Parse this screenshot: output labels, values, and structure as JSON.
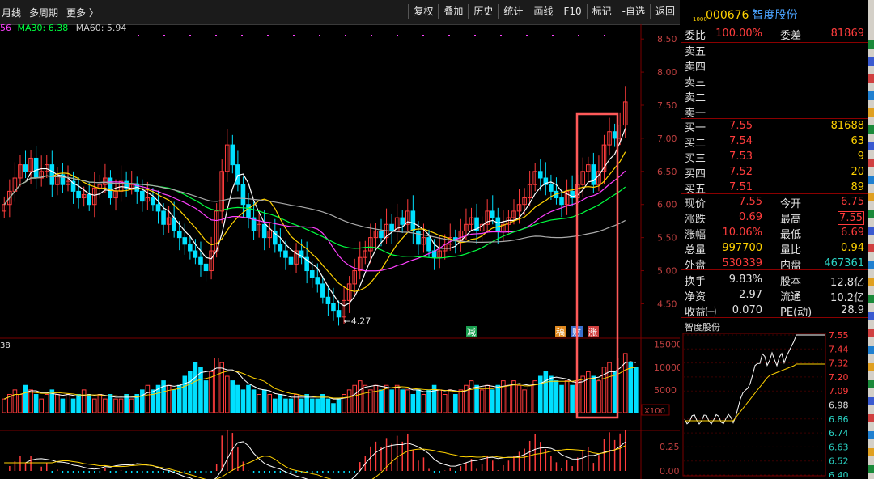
{
  "toolbar": {
    "left": [
      "月线",
      "多周期",
      "更多 〉"
    ],
    "right": [
      "复权",
      "叠加",
      "历史",
      "统计",
      "画线",
      "F10",
      "标记",
      "-自选",
      "返回"
    ]
  },
  "ma_legend": {
    "ma_prefix": "56",
    "ma30": "MA30: 6.38",
    "ma60": "MA60: 5.94"
  },
  "colors": {
    "up": "#ff3c3c",
    "down": "#00e0ff",
    "ma5": "#ffffff",
    "ma10": "#ffd200",
    "ma20": "#ff40ff",
    "ma30": "#00ff40",
    "ma60": "#aaaaaa",
    "highlight": "#ff5a5a"
  },
  "stock": {
    "code": "000676",
    "name": "智度股份",
    "tag": "1000"
  },
  "quote": {
    "weibi_label": "委比",
    "weibi": "100.00%",
    "weicha_label": "委差",
    "weicha": "81869",
    "sells": [
      {
        "label": "卖五"
      },
      {
        "label": "卖四"
      },
      {
        "label": "卖三"
      },
      {
        "label": "卖二"
      },
      {
        "label": "卖一"
      }
    ],
    "buys": [
      {
        "label": "买一",
        "price": "7.55",
        "vol": "81688"
      },
      {
        "label": "买二",
        "price": "7.54",
        "vol": "63"
      },
      {
        "label": "买三",
        "price": "7.53",
        "vol": "9"
      },
      {
        "label": "买四",
        "price": "7.52",
        "vol": "20"
      },
      {
        "label": "买五",
        "price": "7.51",
        "vol": "89"
      }
    ],
    "stats": [
      {
        "a": "现价",
        "b": "7.55",
        "bc": "red",
        "c": "今开",
        "d": "6.75",
        "dc": "red"
      },
      {
        "a": "涨跌",
        "b": "0.69",
        "bc": "red",
        "c": "最高",
        "d": "7.55",
        "dc": "red"
      },
      {
        "a": "涨幅",
        "b": "10.06%",
        "bc": "red",
        "c": "最低",
        "d": "6.69",
        "dc": "red"
      },
      {
        "a": "总量",
        "b": "997700",
        "bc": "yel",
        "c": "量比",
        "d": "0.94",
        "dc": "yel"
      },
      {
        "a": "外盘",
        "b": "530339",
        "bc": "red",
        "c": "内盘",
        "d": "467361",
        "dc": "grn"
      },
      {
        "a": "换手",
        "b": "9.83%",
        "bc": "wht",
        "c": "股本",
        "d": "12.8亿",
        "dc": "wht"
      },
      {
        "a": "净资",
        "b": "2.97",
        "bc": "wht",
        "c": "流通",
        "d": "10.2亿",
        "dc": "wht"
      },
      {
        "a": "收益㈠",
        "b": "0.070",
        "bc": "wht",
        "c": "PE(动)",
        "d": "28.9",
        "dc": "wht"
      }
    ]
  },
  "main_chart": {
    "y_ticks": [
      "8.50",
      "8.00",
      "7.50",
      "7.00",
      "6.50",
      "6.00",
      "5.50",
      "5.00",
      "4.50"
    ],
    "low_marker": "4.27",
    "event_labels": [
      "减",
      "稿",
      "财",
      "涨"
    ],
    "volume_ticks": [
      "15000",
      "10000",
      "5000"
    ],
    "volume_unit": "X100",
    "macd_ticks": [
      "0.25",
      "0.00"
    ],
    "left_volume_label": "38"
  },
  "mini_chart": {
    "title": "智度股份",
    "ticks": [
      "7.55",
      "7.44",
      "7.32",
      "7.20",
      "7.09",
      "6.98",
      "6.86",
      "6.74",
      "6.63",
      "6.52",
      "6.40"
    ]
  },
  "chart_data": {
    "type": "candlestick",
    "ylim": [
      4.2,
      8.6
    ],
    "closes": [
      6.0,
      6.2,
      6.4,
      6.6,
      6.5,
      6.7,
      6.4,
      6.5,
      6.6,
      6.3,
      6.45,
      6.3,
      6.35,
      6.2,
      6.1,
      6.15,
      6.0,
      6.25,
      6.3,
      6.4,
      6.1,
      6.2,
      6.35,
      6.25,
      6.3,
      6.2,
      6.05,
      6.1,
      6.0,
      5.9,
      5.7,
      5.8,
      5.6,
      5.5,
      5.4,
      5.3,
      5.2,
      5.1,
      5.0,
      5.3,
      5.9,
      6.5,
      6.9,
      6.6,
      6.3,
      6.0,
      5.8,
      5.6,
      5.7,
      5.5,
      5.6,
      5.4,
      5.3,
      5.2,
      5.1,
      5.3,
      5.2,
      5.0,
      4.9,
      4.8,
      4.6,
      4.5,
      4.4,
      4.3,
      4.55,
      4.8,
      5.0,
      5.2,
      5.3,
      5.5,
      5.6,
      5.5,
      5.7,
      5.6,
      5.8,
      5.7,
      5.9,
      5.6,
      5.4,
      5.5,
      5.3,
      5.2,
      5.3,
      5.4,
      5.5,
      5.45,
      5.6,
      5.7,
      5.8,
      5.6,
      5.7,
      5.9,
      5.8,
      5.6,
      5.7,
      5.8,
      5.9,
      6.0,
      6.1,
      6.3,
      6.5,
      6.4,
      6.3,
      6.2,
      6.1,
      6.0,
      6.2,
      6.1,
      6.3,
      6.5,
      6.6,
      6.3,
      6.5,
      6.9,
      7.1,
      7.0,
      7.2,
      7.55
    ],
    "volume": [
      3,
      4,
      5,
      4,
      6,
      5,
      4,
      3,
      4,
      5,
      4,
      3,
      4,
      3,
      4,
      5,
      4,
      3,
      4,
      3,
      4,
      3,
      3,
      4,
      3,
      4,
      5,
      6,
      5,
      6,
      7,
      6,
      5,
      6,
      8,
      9,
      11,
      10,
      7,
      9,
      12,
      11,
      8,
      7,
      6,
      5,
      6,
      5,
      4,
      5,
      4,
      3,
      4,
      3,
      3,
      4,
      3,
      4,
      3,
      3,
      4,
      3,
      2,
      3,
      4,
      5,
      6,
      7,
      6,
      5,
      6,
      5,
      6,
      5,
      6,
      5,
      5,
      4,
      5,
      4,
      5,
      6,
      5,
      4,
      5,
      4,
      5,
      6,
      7,
      6,
      5,
      6,
      5,
      6,
      7,
      6,
      7,
      6,
      5,
      6,
      7,
      8,
      9,
      8,
      7,
      6,
      7,
      6,
      7,
      8,
      9,
      8,
      7,
      10,
      11,
      9,
      12,
      13,
      11,
      10
    ]
  }
}
